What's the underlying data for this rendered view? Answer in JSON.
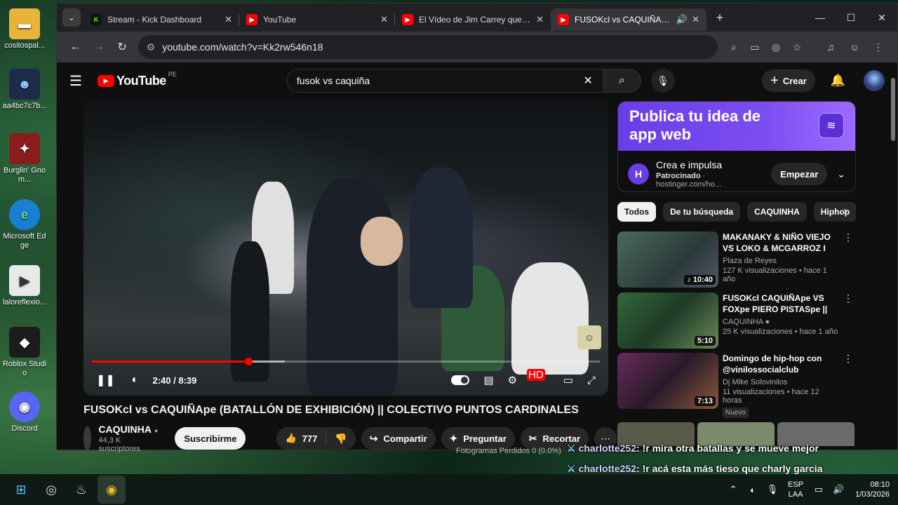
{
  "desktop": {
    "icons": [
      {
        "label": "cositospal...",
        "icon": "folder-icon",
        "color": "#e8b339"
      },
      {
        "label": "aa4bc7c7b...",
        "icon": "avatar-art-icon",
        "color": "#1e2a4a"
      },
      {
        "label": "Burglin' Gnom...",
        "icon": "game-icon",
        "color": "#8a1c1c"
      },
      {
        "label": "Microsoft Edge",
        "icon": "edge-icon",
        "color": "#1b7fd1"
      },
      {
        "label": "laloreflexio...",
        "icon": "video-file-icon",
        "color": "#e8e8e8"
      },
      {
        "label": "Roblox Studio",
        "icon": "roblox-icon",
        "color": "#1c1c1c"
      },
      {
        "label": "Discord",
        "icon": "discord-icon",
        "color": "#5865f2"
      }
    ]
  },
  "browser": {
    "tabs": [
      {
        "title": "Stream - Kick Dashboard",
        "favicon": "K",
        "favicon_color": "#53fc18",
        "active": false
      },
      {
        "title": "YouTube",
        "favicon": "▶",
        "favicon_color": "#ff0000",
        "active": false
      },
      {
        "title": "El Vídeo de Jim Carrey que es e",
        "favicon": "▶",
        "favicon_color": "#ff0000",
        "active": false
      },
      {
        "title": "FUSOKcl vs CAQUIÑApe (BA",
        "favicon": "▶",
        "favicon_color": "#ff0000",
        "active": true
      }
    ],
    "url": "youtube.com/watch?v=Kk2rw546n18"
  },
  "youtube": {
    "logo": "YouTube",
    "country": "PE",
    "search_query": "fusok vs caquiña",
    "create_label": "Crear"
  },
  "player": {
    "time_display": "2:40 / 8:39",
    "progress_fraction": 0.308,
    "buffered_fraction": 0.38
  },
  "video": {
    "title": "FUSOKcl vs CAQUIÑApe (BATALLÓN DE EXHIBICIÓN) || COLECTIVO PUNTOS CARDINALES",
    "channel": "CAQUINHA",
    "subscribers": "44,3 K suscriptores",
    "subscribe_label": "Suscribirme",
    "likes": "777",
    "share_label": "Compartir",
    "ask_label": "Preguntar",
    "clip_label": "Recortar"
  },
  "ad": {
    "headline": "Publica tu idea de app web",
    "title": "Crea e impulsa",
    "sponsored": "Patrocinado",
    "domain": "hostinger.com/ho...",
    "cta": "Empezar"
  },
  "chips": [
    "Todos",
    "De tu búsqueda",
    "CAQUINHA",
    "Hiphop"
  ],
  "recommendations": [
    {
      "title": "MAKANAKY & NIÑO VIEJO  VS LOKO & MCGARROZ I  NIÑO ...",
      "channel": "Plaza de Reyes",
      "meta": "127 K visualizaciones • hace 1 año",
      "duration": "10:40",
      "thumb_color": "#3a5a4a",
      "new": ""
    },
    {
      "title": "FUSOKcl CAQUIÑApe VS FOXpe PIERO PISTASpe || EXHIBICIÓ...",
      "channel": "CAQUINHA",
      "meta": "25 K visualizaciones • hace 1 año",
      "duration": "5:10",
      "thumb_color": "#2f6a3a",
      "new": ""
    },
    {
      "title": "Domingo de hip-hop con @vinilossocialclub",
      "channel": "Dj Mike Solovinilos",
      "meta": "11 visualizaciones • hace 12 horas",
      "duration": "7:13",
      "thumb_color": "#5a2a4a",
      "new": "Nuevo"
    }
  ],
  "chat": [
    {
      "user": "charlotte252",
      "message": "!r mira otra batallas y se mueve mejor"
    },
    {
      "user": "charlotte252",
      "message": "!r acá esta más tieso que charly garcia"
    }
  ],
  "obs_status": "Fotogramas Perdidos 0 (0.0%)",
  "taskbar": {
    "lang_top": "ESP",
    "lang_bottom": "LAA",
    "time": "08:10",
    "date": "1/03/2026"
  }
}
